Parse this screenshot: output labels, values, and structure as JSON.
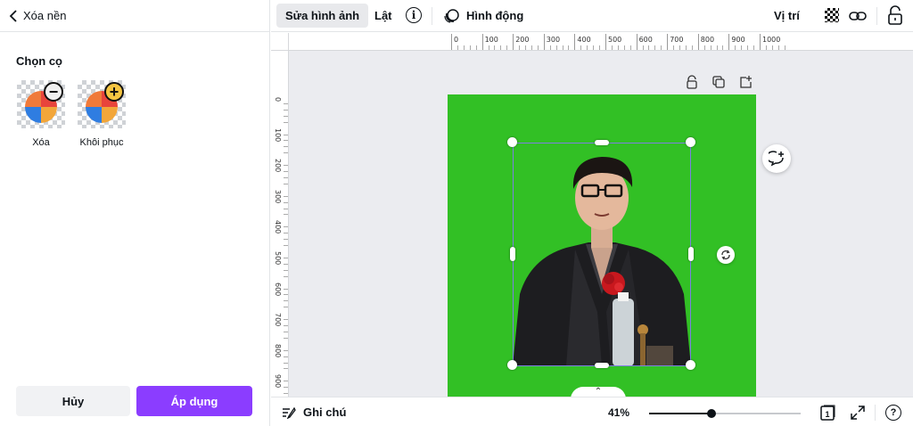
{
  "left_panel": {
    "back_label": "Xóa nền",
    "section_title": "Chọn cọ",
    "brushes": [
      {
        "label": "Xóa",
        "icon": "erase-brush-icon"
      },
      {
        "label": "Khôi phục",
        "icon": "restore-brush-icon"
      }
    ],
    "cancel_label": "Hủy",
    "apply_label": "Áp dụng"
  },
  "toolbar": {
    "edit_image_label": "Sửa hình ảnh",
    "flip_label": "Lật",
    "info_glyph": "i",
    "animate_label": "Hình động",
    "position_label": "Vị trí"
  },
  "ruler": {
    "top_ticks": [
      "0",
      "100",
      "200",
      "300",
      "400",
      "500",
      "600",
      "700",
      "800",
      "900",
      "1000"
    ],
    "left_ticks": [
      "0",
      "100",
      "200",
      "300",
      "400",
      "500",
      "600",
      "700",
      "800",
      "900"
    ]
  },
  "canvas": {
    "page_color": "#32c025",
    "selection_color": "#7d7fe0",
    "collapse_glyph": "⌃"
  },
  "bottom_bar": {
    "notes_label": "Ghi chú",
    "zoom_label": "41%",
    "zoom_fraction": 0.41,
    "page_count": "1",
    "help_glyph": "?"
  },
  "colors": {
    "accent": "#8b3dff",
    "cancel_bg": "#f1f2f4"
  }
}
